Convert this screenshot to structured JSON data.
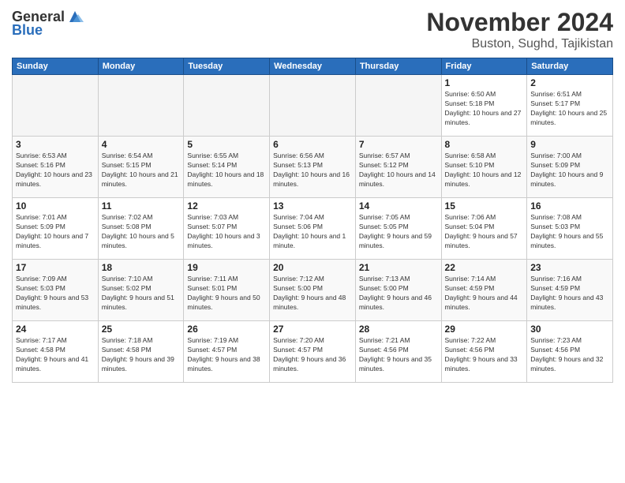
{
  "logo": {
    "general": "General",
    "blue": "Blue"
  },
  "title": "November 2024",
  "location": "Buston, Sughd, Tajikistan",
  "weekdays": [
    "Sunday",
    "Monday",
    "Tuesday",
    "Wednesday",
    "Thursday",
    "Friday",
    "Saturday"
  ],
  "weeks": [
    [
      {
        "day": "",
        "info": ""
      },
      {
        "day": "",
        "info": ""
      },
      {
        "day": "",
        "info": ""
      },
      {
        "day": "",
        "info": ""
      },
      {
        "day": "",
        "info": ""
      },
      {
        "day": "1",
        "info": "Sunrise: 6:50 AM\nSunset: 5:18 PM\nDaylight: 10 hours and 27 minutes."
      },
      {
        "day": "2",
        "info": "Sunrise: 6:51 AM\nSunset: 5:17 PM\nDaylight: 10 hours and 25 minutes."
      }
    ],
    [
      {
        "day": "3",
        "info": "Sunrise: 6:53 AM\nSunset: 5:16 PM\nDaylight: 10 hours and 23 minutes."
      },
      {
        "day": "4",
        "info": "Sunrise: 6:54 AM\nSunset: 5:15 PM\nDaylight: 10 hours and 21 minutes."
      },
      {
        "day": "5",
        "info": "Sunrise: 6:55 AM\nSunset: 5:14 PM\nDaylight: 10 hours and 18 minutes."
      },
      {
        "day": "6",
        "info": "Sunrise: 6:56 AM\nSunset: 5:13 PM\nDaylight: 10 hours and 16 minutes."
      },
      {
        "day": "7",
        "info": "Sunrise: 6:57 AM\nSunset: 5:12 PM\nDaylight: 10 hours and 14 minutes."
      },
      {
        "day": "8",
        "info": "Sunrise: 6:58 AM\nSunset: 5:10 PM\nDaylight: 10 hours and 12 minutes."
      },
      {
        "day": "9",
        "info": "Sunrise: 7:00 AM\nSunset: 5:09 PM\nDaylight: 10 hours and 9 minutes."
      }
    ],
    [
      {
        "day": "10",
        "info": "Sunrise: 7:01 AM\nSunset: 5:09 PM\nDaylight: 10 hours and 7 minutes."
      },
      {
        "day": "11",
        "info": "Sunrise: 7:02 AM\nSunset: 5:08 PM\nDaylight: 10 hours and 5 minutes."
      },
      {
        "day": "12",
        "info": "Sunrise: 7:03 AM\nSunset: 5:07 PM\nDaylight: 10 hours and 3 minutes."
      },
      {
        "day": "13",
        "info": "Sunrise: 7:04 AM\nSunset: 5:06 PM\nDaylight: 10 hours and 1 minute."
      },
      {
        "day": "14",
        "info": "Sunrise: 7:05 AM\nSunset: 5:05 PM\nDaylight: 9 hours and 59 minutes."
      },
      {
        "day": "15",
        "info": "Sunrise: 7:06 AM\nSunset: 5:04 PM\nDaylight: 9 hours and 57 minutes."
      },
      {
        "day": "16",
        "info": "Sunrise: 7:08 AM\nSunset: 5:03 PM\nDaylight: 9 hours and 55 minutes."
      }
    ],
    [
      {
        "day": "17",
        "info": "Sunrise: 7:09 AM\nSunset: 5:03 PM\nDaylight: 9 hours and 53 minutes."
      },
      {
        "day": "18",
        "info": "Sunrise: 7:10 AM\nSunset: 5:02 PM\nDaylight: 9 hours and 51 minutes."
      },
      {
        "day": "19",
        "info": "Sunrise: 7:11 AM\nSunset: 5:01 PM\nDaylight: 9 hours and 50 minutes."
      },
      {
        "day": "20",
        "info": "Sunrise: 7:12 AM\nSunset: 5:00 PM\nDaylight: 9 hours and 48 minutes."
      },
      {
        "day": "21",
        "info": "Sunrise: 7:13 AM\nSunset: 5:00 PM\nDaylight: 9 hours and 46 minutes."
      },
      {
        "day": "22",
        "info": "Sunrise: 7:14 AM\nSunset: 4:59 PM\nDaylight: 9 hours and 44 minutes."
      },
      {
        "day": "23",
        "info": "Sunrise: 7:16 AM\nSunset: 4:59 PM\nDaylight: 9 hours and 43 minutes."
      }
    ],
    [
      {
        "day": "24",
        "info": "Sunrise: 7:17 AM\nSunset: 4:58 PM\nDaylight: 9 hours and 41 minutes."
      },
      {
        "day": "25",
        "info": "Sunrise: 7:18 AM\nSunset: 4:58 PM\nDaylight: 9 hours and 39 minutes."
      },
      {
        "day": "26",
        "info": "Sunrise: 7:19 AM\nSunset: 4:57 PM\nDaylight: 9 hours and 38 minutes."
      },
      {
        "day": "27",
        "info": "Sunrise: 7:20 AM\nSunset: 4:57 PM\nDaylight: 9 hours and 36 minutes."
      },
      {
        "day": "28",
        "info": "Sunrise: 7:21 AM\nSunset: 4:56 PM\nDaylight: 9 hours and 35 minutes."
      },
      {
        "day": "29",
        "info": "Sunrise: 7:22 AM\nSunset: 4:56 PM\nDaylight: 9 hours and 33 minutes."
      },
      {
        "day": "30",
        "info": "Sunrise: 7:23 AM\nSunset: 4:56 PM\nDaylight: 9 hours and 32 minutes."
      }
    ]
  ]
}
